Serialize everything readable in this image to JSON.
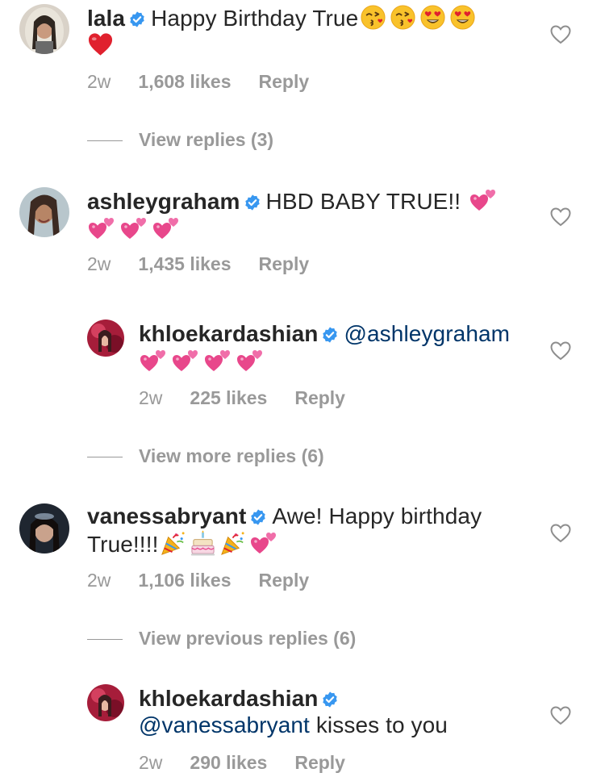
{
  "comments": [
    {
      "username": "lala",
      "text": "Happy Birthday True",
      "emojis_line1": [
        "kiss-face",
        "kiss-face",
        "heart-eyes",
        "heart-eyes"
      ],
      "emojis_line2": [
        "red-heart"
      ],
      "time": "2w",
      "likes": "1,608 likes",
      "reply": "Reply",
      "view_replies": "View replies (3)"
    },
    {
      "username": "ashleygraham",
      "text": "HBD BABY TRUE!!",
      "emojis_line1": [
        "two-hearts"
      ],
      "emojis_line2": [
        "two-hearts",
        "two-hearts",
        "two-hearts"
      ],
      "time": "2w",
      "likes": "1,435 likes",
      "reply": "Reply"
    },
    {
      "username": "khloekardashian",
      "mention": "@ashleygraham",
      "emojis_line2": [
        "two-hearts",
        "two-hearts",
        "two-hearts",
        "two-hearts"
      ],
      "time": "2w",
      "likes": "225 likes",
      "reply": "Reply",
      "view_replies": "View more replies (6)"
    },
    {
      "username": "vanessabryant",
      "text": "Awe! Happy birthday",
      "text_line2": "True!!!!",
      "emojis_line2": [
        "party-popper",
        "birthday-cake",
        "party-popper",
        "two-hearts"
      ],
      "time": "2w",
      "likes": "1,106 likes",
      "reply": "Reply",
      "view_replies": "View previous replies (6)"
    },
    {
      "username": "khloekardashian",
      "mention": "@vanessabryant",
      "text": "kisses to you",
      "time": "2w",
      "likes": "290 likes",
      "reply": "Reply"
    }
  ],
  "colors": {
    "text": "#262626",
    "meta": "#999999",
    "mention": "#003569",
    "verified": "#3897f0",
    "emoji_pink": "#e8478b"
  }
}
